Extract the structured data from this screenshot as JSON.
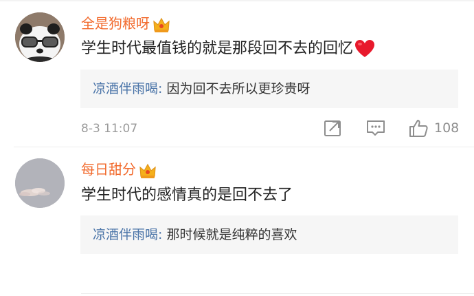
{
  "comments": [
    {
      "username": "全是狗粮呀",
      "text": "学生时代最值钱的就是那段回不去的回忆",
      "reply": {
        "author": "凉酒伴雨喝",
        "separator": ":",
        "text": " 因为回不去所以更珍贵呀"
      },
      "time": "8-3 11:07",
      "likes": "108",
      "avatar_icon": "panda-sunglasses-avatar",
      "badge_icon": "crown-icon",
      "emoji_icon": "red-heart-icon"
    },
    {
      "username": "每日甜分",
      "text": "学生时代的感情真的是回不去了",
      "reply": {
        "author": "凉酒伴雨喝",
        "separator": ":",
        "text": " 那时候就是纯粹的喜欢"
      },
      "avatar_icon": "sky-clouds-avatar",
      "badge_icon": "crown-icon"
    }
  ],
  "colors": {
    "username": "#f26b2e",
    "reply_author": "#4a74a8",
    "meta_text": "#9a9a9a",
    "reply_bg": "#f6f6f6"
  }
}
